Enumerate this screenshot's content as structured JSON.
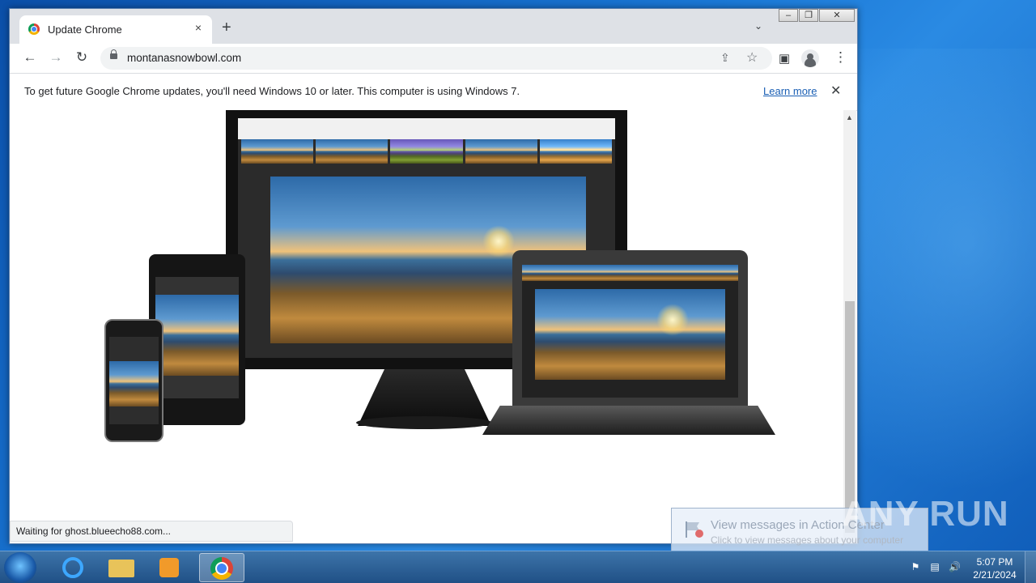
{
  "browser": {
    "tab": {
      "title": "Update Chrome",
      "close": "×"
    },
    "new_tab": "+",
    "tab_search": "⌄",
    "window_controls": {
      "minimize": "–",
      "restore": "❐",
      "close": "✕"
    },
    "nav": {
      "back": "←",
      "forward": "→",
      "reload": "↻"
    },
    "url": "montanasnowbowl.com",
    "icons": {
      "share": "⇪",
      "bookmark": "☆",
      "side_panel": "▣",
      "menu": "⋮"
    }
  },
  "infobar": {
    "message": "To get future Google Chrome updates, you'll need Windows 10 or later. This computer is using Windows 7.",
    "learn_more": "Learn more",
    "close": "✕"
  },
  "page": {
    "scroll_up": "▲"
  },
  "status_bar": {
    "text": "Waiting for ghost.blueecho88.com..."
  },
  "notification": {
    "title": "View messages in Action Center",
    "subtitle": "Click to view messages about your computer"
  },
  "watermark": "ANY RUN",
  "taskbar": {
    "clock_time": "5:07 PM",
    "clock_date": "2/21/2024"
  }
}
